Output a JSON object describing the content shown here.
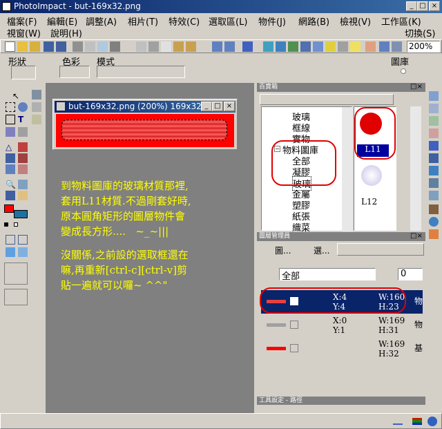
{
  "app": {
    "title": "PhotoImpact - but-169x32.png"
  },
  "menu": {
    "row1": [
      "檔案(F)",
      "編輯(E)",
      "調整(A)",
      "相片(T)",
      "特效(C)",
      "選取區(L)",
      "物件(J)",
      "網路(B)",
      "檢視(V)",
      "工作區(K)"
    ],
    "row2": [
      "視窗(W)",
      "說明(H)"
    ],
    "switch_label": "切換(S)"
  },
  "toolbar": {
    "zoom_value": "200%"
  },
  "attrbar": {
    "shape_label": "形狀",
    "color_label": "色彩",
    "mode_label": "模式",
    "layer_label": "圖庫"
  },
  "document": {
    "title": "but-169x32.png (200%) 169x32",
    "notes": [
      "到物料圖庫的玻璃材質那裡,\n套用L11材質.不過剛套好時,\n原本圓角矩形的圖層物件會\n變成長方形....   ~_~|||",
      "沒關係,之前設的選取框還在\n嘛,再重新[ctrl-c][ctrl-v]剪\n貼一遍就可以囉~ ^^\""
    ]
  },
  "treasure": {
    "title": "百寶箱",
    "tree": [
      "玻璃",
      "框線",
      "實物",
      "物料圖庫",
      "全部",
      "凝膠",
      "玻璃",
      "金屬",
      "塑膠",
      "紙張",
      "織菜"
    ],
    "thumb_labels": [
      "L11",
      "L12"
    ]
  },
  "layers": {
    "title": "圖層管理員",
    "tab1": "圖...",
    "tab2": "選...",
    "filter_value": "全部",
    "opacity_value": "0",
    "rows": [
      {
        "x": "X:4",
        "y": "Y:4",
        "w": "W:160",
        "h": "H:23",
        "tail": "物",
        "bar_color": "#e84040"
      },
      {
        "x": "X:0",
        "y": "Y:1",
        "w": "W:169",
        "h": "H:31",
        "tail": "物",
        "bar_color": "#a0a0a0"
      },
      {
        "x": "",
        "y": "",
        "w": "W:169",
        "h": "H:32",
        "tail": "基",
        "bar_color": "#ff0000"
      }
    ]
  },
  "toolpanel_title": "工具設定 - 路徑"
}
